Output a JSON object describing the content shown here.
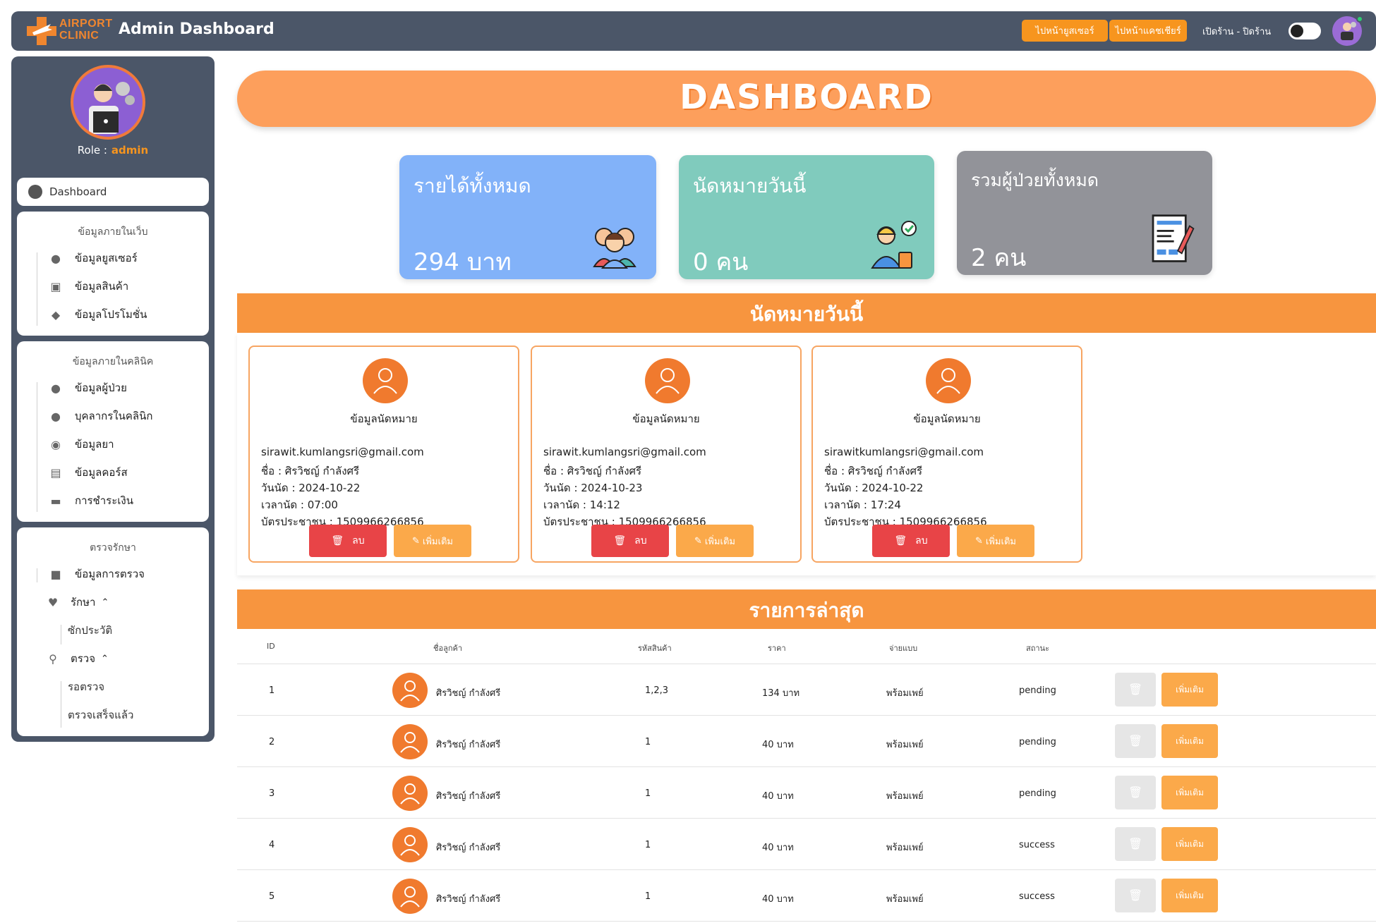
{
  "topbar": {
    "logo_line1": "AIRPORT",
    "logo_line2": "CLINIC",
    "title": "Admin Dashboard",
    "btn_user": "ไปหน้ายูสเซอร์",
    "btn_cashier": "ไปหน้าแคชเชียร์",
    "shop_toggle_label": "เปิดร้าน - ปิดร้าน"
  },
  "sidebar": {
    "role_label": "Role :",
    "role_value": "admin",
    "dashboard": "Dashboard",
    "web_section": {
      "title": "ข้อมูลภายในเว็บ",
      "items": [
        "ข้อมูลยูสเซอร์",
        "ข้อมูลสินค้า",
        "ข้อมูลโปรโมชั่น"
      ]
    },
    "clinic_section": {
      "title": "ข้อมูลภายในคลินิค",
      "items": [
        "ข้อมูลผู้ป่วย",
        "บุคลากรในคลินิก",
        "ข้อมูลยา",
        "ข้อมูลคอร์ส",
        "การชำระเงิน"
      ]
    },
    "treat_section": {
      "title": "ตรวจรักษา",
      "exam_data": "ข้อมูลการตรวจ",
      "treat": "รักษา",
      "history": "ซักประวัติ",
      "check": "ตรวจ",
      "waiting": "รอตรวจ",
      "done": "ตรวจเสร็จแล้ว"
    }
  },
  "main": {
    "banner": "DASHBOARD",
    "stats": {
      "revenue_label": "รายได้ทั้งหมด",
      "revenue_value": "294 บาท",
      "appt_label": "นัดหมายวันนี้",
      "appt_value": "0 คน",
      "patients_label": "รวมผู้ป่วยทั้งหมด",
      "patients_value": "2 คน"
    },
    "appt_section_title": "นัดหมายวันนี้",
    "appointments": [
      {
        "title": "ข้อมูลนัดหมาย",
        "email": "sirawit.kumlangsri@gmail.com",
        "name": "ชื่อ : ศิรวิชญ์ กำลังศรี",
        "date": "วันนัด : 2024-10-22",
        "time": "เวลานัด : 07:00",
        "id_card": "บัตรประชาชน : 1509966266856",
        "del": "ลบ",
        "add": "เพิ่มเติม"
      },
      {
        "title": "ข้อมูลนัดหมาย",
        "email": "sirawit.kumlangsri@gmail.com",
        "name": "ชื่อ : ศิรวิชญ์ กำลังศรี",
        "date": "วันนัด : 2024-10-23",
        "time": "เวลานัด : 14:12",
        "id_card": "บัตรประชาชน : 1509966266856",
        "del": "ลบ",
        "add": "เพิ่มเติม"
      },
      {
        "title": "ข้อมูลนัดหมาย",
        "email": "sirawitkumlangsri@gmail.com",
        "name": "ชื่อ : ศิรวิชญ์ กำลังศรี",
        "date": "วันนัด : 2024-10-22",
        "time": "เวลานัด : 17:24",
        "id_card": "บัตรประชาชน : 1509966266856",
        "del": "ลบ",
        "add": "เพิ่มเติม"
      }
    ],
    "recent_section_title": "รายการล่าสุด",
    "table": {
      "headers": [
        "ID",
        "ชื่อลูกค้า",
        "รหัสสินค้า",
        "ราคา",
        "จ่ายแบบ",
        "สถานะ"
      ],
      "add_label": "เพิ่มเติม",
      "rows": [
        {
          "id": "1",
          "customer": "ศิรวิชญ์ กำลังศรี",
          "product": "1,2,3",
          "price": "134 บาท",
          "pay": "พร้อมเพย์",
          "status": "pending"
        },
        {
          "id": "2",
          "customer": "ศิรวิชญ์ กำลังศรี",
          "product": "1",
          "price": "40 บาท",
          "pay": "พร้อมเพย์",
          "status": "pending"
        },
        {
          "id": "3",
          "customer": "ศิรวิชญ์ กำลังศรี",
          "product": "1",
          "price": "40 บาท",
          "pay": "พร้อมเพย์",
          "status": "pending"
        },
        {
          "id": "4",
          "customer": "ศิรวิชญ์ กำลังศรี",
          "product": "1",
          "price": "40 บาท",
          "pay": "พร้อมเพย์",
          "status": "success"
        },
        {
          "id": "5",
          "customer": "ศิรวิชญ์ กำลังศรี",
          "product": "1",
          "price": "40 บาท",
          "pay": "พร้อมเพย์",
          "status": "success"
        }
      ]
    }
  },
  "colors": {
    "topbar_bg": "#4b5668",
    "accent_orange": "#f7953f",
    "revenue_card": "#82b2f9",
    "appt_card": "#80cbbd",
    "patients_card": "#929399",
    "delete_red": "#e84447"
  },
  "icons": [
    "logo-icon",
    "dashboard-icon",
    "user-icon",
    "box-icon",
    "tag-icon",
    "patient-icon",
    "staff-icon",
    "pill-icon",
    "course-icon",
    "credit-card-icon",
    "folder-icon",
    "heartbeat-icon",
    "search-icon",
    "trash-icon",
    "edit-icon",
    "avatar-icon"
  ]
}
